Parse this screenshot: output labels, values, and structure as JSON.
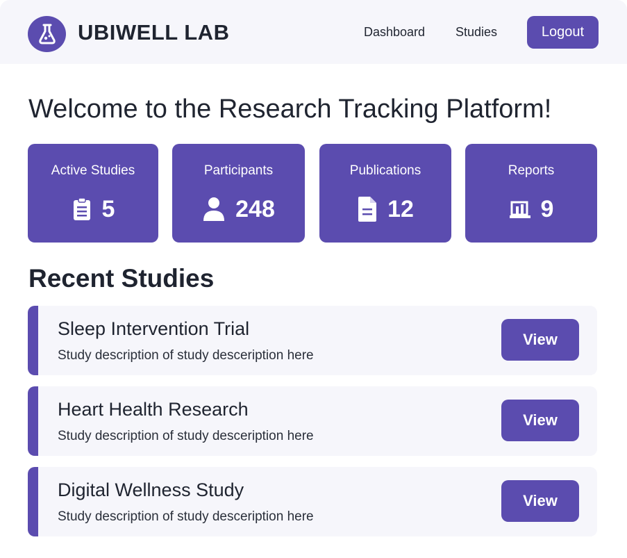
{
  "header": {
    "brand": "UBIWELL LAB",
    "nav": [
      {
        "label": "Dashboard"
      },
      {
        "label": "Studies"
      }
    ],
    "logout_label": "Logout",
    "logo_icon": "flask-icon"
  },
  "welcome_title": "Welcome to the Research Tracking Platform!",
  "stats": [
    {
      "label": "Active Studies",
      "value": "5",
      "icon": "clipboard-icon"
    },
    {
      "label": "Participants",
      "value": "248",
      "icon": "user-icon"
    },
    {
      "label": "Publications",
      "value": "12",
      "icon": "document-icon"
    },
    {
      "label": "Reports",
      "value": "9",
      "icon": "report-icon"
    }
  ],
  "recent": {
    "title": "Recent Studies",
    "studies": [
      {
        "title": "Sleep Intervention Trial",
        "description": "Study description of study desceription here",
        "action": "View"
      },
      {
        "title": "Heart Health Research",
        "description": "Study description of study desceription here",
        "action": "View"
      },
      {
        "title": "Digital Wellness Study",
        "description": "Study description of study desceription here",
        "action": "View"
      }
    ]
  },
  "colors": {
    "accent": "#5b4caf",
    "header_bg": "#f6f6fb",
    "card_bg": "#f6f6fb",
    "text": "#1f2430"
  }
}
